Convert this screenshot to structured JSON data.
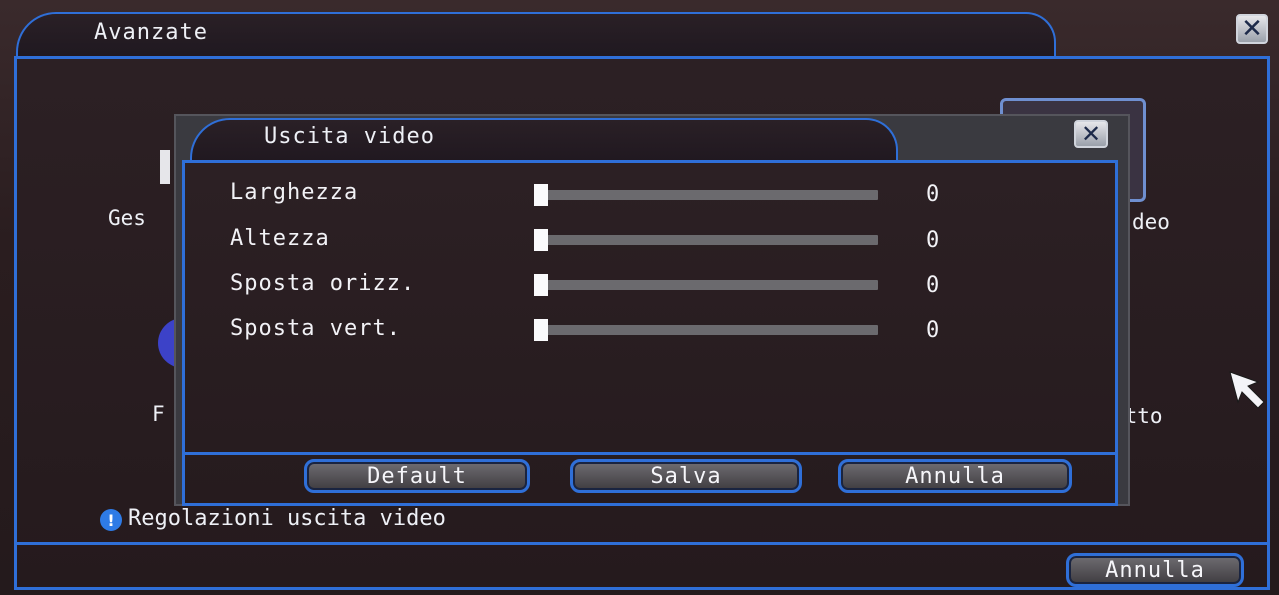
{
  "outer": {
    "title": "Avanzate",
    "close_glyph": "✕",
    "background_labels": [
      "Ges",
      "deo",
      "F",
      "otto"
    ],
    "hint_icon": "!",
    "hint": "Regolazioni uscita video",
    "cancel_label": "Annulla"
  },
  "dialog": {
    "title": "Uscita video",
    "close_glyph": "✕",
    "rows": [
      {
        "label": "Larghezza",
        "value": "0",
        "level": 0
      },
      {
        "label": "Altezza",
        "value": "0",
        "level": 0
      },
      {
        "label": "Sposta orizz.",
        "value": "0",
        "level": 0
      },
      {
        "label": "Sposta vert.",
        "value": "0",
        "level": 0
      }
    ],
    "buttons": {
      "default_label": "Default",
      "save_label": "Salva",
      "cancel_label": "Annulla"
    }
  },
  "colors": {
    "accent_blue": "#2f6fd8",
    "background": "#2b1e20",
    "button_fill": "#5a585c",
    "slider_track": "#6b6a6e",
    "slider_thumb": "#fafafc"
  },
  "icons": [
    "close-icon",
    "info-icon",
    "mouse-cursor-icon"
  ]
}
